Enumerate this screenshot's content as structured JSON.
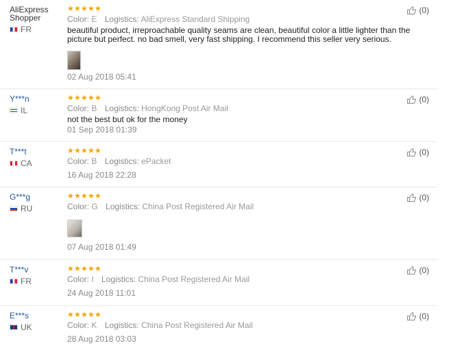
{
  "reviews": [
    {
      "user": "AliExpress Shopper",
      "country": "FR",
      "flag": "fr",
      "color": "E",
      "logistics": "AliExpress Standard Shipping",
      "text": "beautiful product, irreproachable quality seams are clean, beautiful color a little lighter than the picture but perfect. no bad smell, very fast shipping. I recommend this seller very serious.",
      "has_photo": true,
      "date": "02 Aug 2018 05:41",
      "helpful": "(0)",
      "rating": 5
    },
    {
      "user": "Y***n",
      "country": "IL",
      "flag": "il",
      "color": "B",
      "logistics": "HongKong Post Air Mail",
      "text": "not the best but ok for the money",
      "has_photo": false,
      "date": "01 Sep 2018 01:39",
      "helpful": "(0)",
      "rating": 5
    },
    {
      "user": "T***t",
      "country": "CA",
      "flag": "ca",
      "color": "B",
      "logistics": "ePacket",
      "text": "",
      "has_photo": false,
      "date": "16 Aug 2018 22:28",
      "helpful": "(0)",
      "rating": 5
    },
    {
      "user": "G***g",
      "country": "RU",
      "flag": "ru",
      "color": "G",
      "logistics": "China Post Registered Air Mail",
      "text": "",
      "has_photo": true,
      "date": "07 Aug 2018 01:49",
      "helpful": "(0)",
      "rating": 5
    },
    {
      "user": "T***v",
      "country": "FR",
      "flag": "fr",
      "color": "I",
      "logistics": "China Post Registered Air Mail",
      "text": "",
      "has_photo": false,
      "date": "24 Aug 2018 11:01",
      "helpful": "(0)",
      "rating": 5
    },
    {
      "user": "E***s",
      "country": "UK",
      "flag": "uk",
      "color": "K",
      "logistics": "China Post Registered Air Mail",
      "text": "",
      "has_photo": false,
      "date": "28 Aug 2018 03:03",
      "helpful": "(0)",
      "rating": 5
    }
  ],
  "labels": {
    "color": "Color:",
    "logistics": "Logistics:"
  },
  "colors": {
    "accent_user": "#2255a4",
    "star": "#f5a500"
  }
}
